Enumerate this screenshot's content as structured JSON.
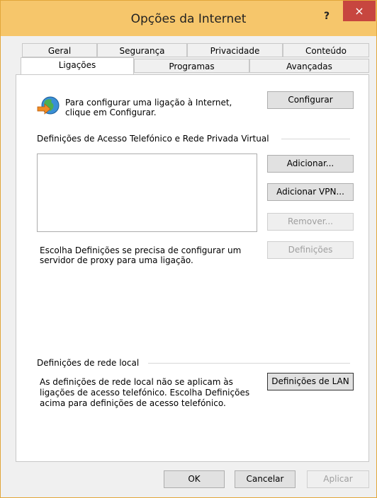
{
  "window": {
    "title": "Opções da Internet",
    "help": "?",
    "close": "×"
  },
  "tabs_row1": [
    "Geral",
    "Segurança",
    "Privacidade",
    "Conteúdo"
  ],
  "tabs_row2": [
    "Ligações",
    "Programas",
    "Avançadas"
  ],
  "setup": {
    "text_line1": "Para configurar uma ligação à Internet,",
    "text_line2": "clique em Configurar.",
    "button": "Configurar"
  },
  "dialup": {
    "group_label": "Definições de Acesso Telefónico e Rede Privada Virtual",
    "add_button": "Adicionar...",
    "add_vpn_button": "Adicionar VPN...",
    "remove_button": "Remover...",
    "settings_button": "Definições",
    "proxy_line1": "Escolha Definições se precisa de configurar um",
    "proxy_line2": "servidor de proxy para uma ligação."
  },
  "lan": {
    "group_label": "Definições de rede local",
    "text_line1": "As definições de rede local não se aplicam às",
    "text_line2": "ligações de acesso telefónico. Escolha Definições",
    "text_line3": "acima para definições de acesso telefónico.",
    "button": "Definições de LAN"
  },
  "footer": {
    "ok": "OK",
    "cancel": "Cancelar",
    "apply": "Aplicar"
  }
}
